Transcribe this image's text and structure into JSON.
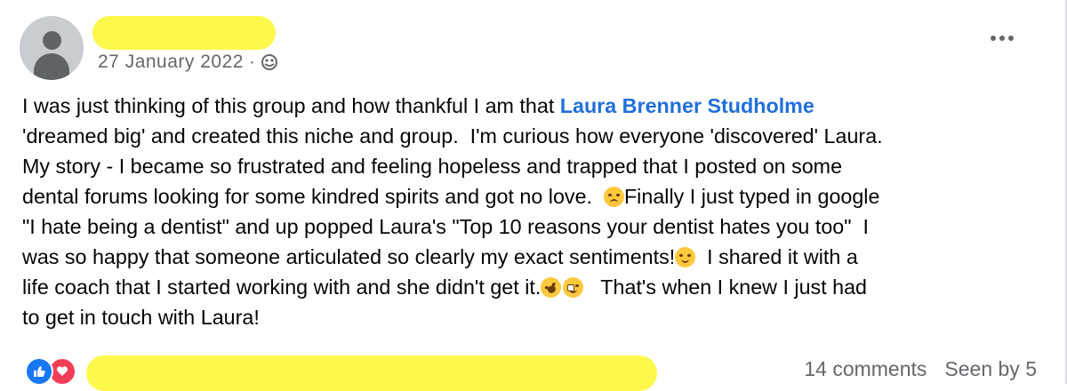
{
  "post": {
    "date": "27 January 2022",
    "separator": "·",
    "audience_icon": "group-icon",
    "text": {
      "l1_pre": "I was just thinking of this group and how thankful I am that ",
      "mention": "Laura Brenner Studholme",
      "l2": "'dreamed big' and created this niche and group.  I'm curious how everyone 'discovered' Laura.",
      "l3": "My story - I became so frustrated and feeling hopeless and trapped that I posted on some",
      "l4_pre": "dental forums looking for some kindred spirits and got no love.  ",
      "l4_post": "Finally I just typed in google",
      "l5": "\"I hate being a dentist\" and up popped Laura's \"Top 10 reasons your dentist hates you too\"  I",
      "l6_pre": "was so happy that someone articulated so clearly my exact sentiments!",
      "l6_post": "  I shared it with a",
      "l7_pre": "life coach that I started working with and she didn't get it.",
      "l7_post": "   That's when I knew I just had",
      "l8": "to get in touch with Laura!"
    }
  },
  "footer": {
    "comments": "14 comments",
    "seen": "Seen by 5",
    "reactions": [
      "like",
      "love"
    ]
  },
  "colors": {
    "mention": "#216fdb",
    "meta": "#65676b",
    "redaction": "#fdf94c"
  }
}
